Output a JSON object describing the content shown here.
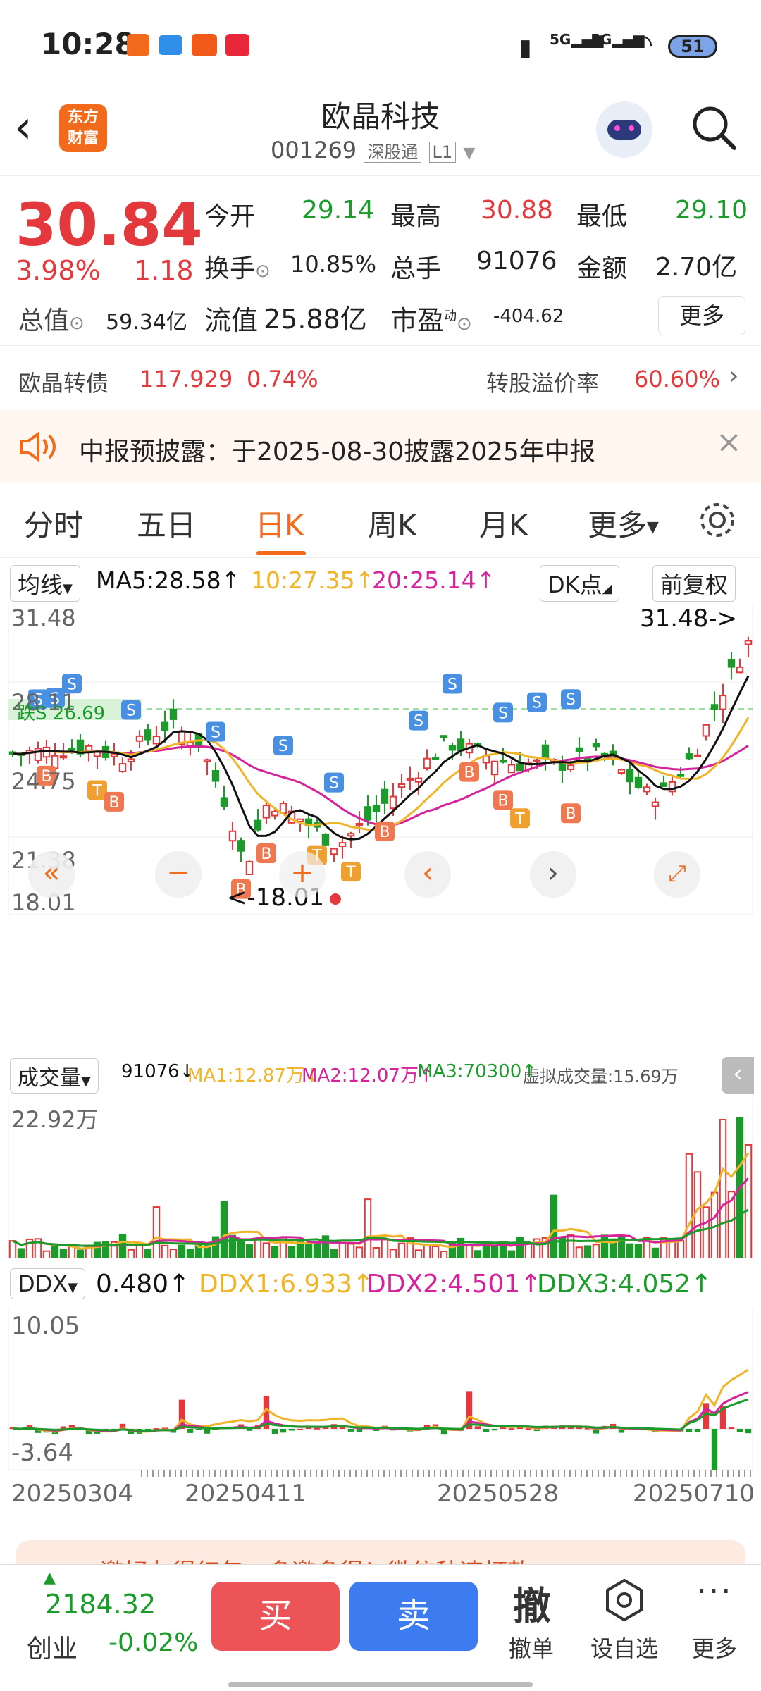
{
  "status_bar": {
    "time": "10:28",
    "battery": "51",
    "network1": "5G",
    "network2": "5G"
  },
  "header": {
    "title": "欧晶科技",
    "code": "001269",
    "market_tag": "深股通",
    "level_tag": "L1",
    "logo_text_1": "东方",
    "logo_text_2": "财富"
  },
  "quote": {
    "price": "30.84",
    "change_pct": "3.98%",
    "change_amt": "1.18",
    "open_label": "今开",
    "open": "29.14",
    "high_label": "最高",
    "high": "30.88",
    "low_label": "最低",
    "low": "29.10",
    "turnover_label": "换手",
    "turnover": "10.85%",
    "volume_label": "总手",
    "volume": "91076",
    "amount_label": "金额",
    "amount": "2.70亿",
    "mcap_label": "总值",
    "mcap": "59.34亿",
    "float_label": "流值",
    "float": "25.88亿",
    "pe_label": "市盈",
    "pe_sup": "动",
    "pe": "-404.62",
    "more_label": "更多"
  },
  "bond": {
    "name": "欧晶转债",
    "price": "117.929",
    "pct": "0.74%",
    "premium_label": "转股溢价率",
    "premium": "60.60%"
  },
  "notice": {
    "text": "中报预披露：于2025-08-30披露2025年中报"
  },
  "tabs": [
    "分时",
    "五日",
    "日K",
    "周K",
    "月K",
    "更多"
  ],
  "active_tab": 2,
  "kline": {
    "ma_select": "均线",
    "ma5": "MA5:28.58",
    "ma10": "10:27.35",
    "ma20": "20:25.14",
    "dk_label": "DK点",
    "adjust_label": "前复权",
    "y_max": "31.48",
    "y_2": "28.11",
    "y_3": "24.75",
    "y_4": "21.38",
    "y_min": "18.01",
    "max_tag": "31.48->",
    "min_tag": "<-18.01",
    "stop_label": "跌S",
    "stop_value": "26.69",
    "colors": {
      "up": "#e4393c",
      "down": "#1a9b2a",
      "ma5": "#111111",
      "ma10": "#f0b428",
      "ma20": "#d4239b"
    }
  },
  "volume": {
    "select": "成交量",
    "current": "91076",
    "ma1": "MA1:12.87万",
    "ma2": "MA2:12.07万",
    "ma3": "MA3:70300",
    "virtual": "虚拟成交量:15.69万",
    "y_max": "22.92万"
  },
  "ddx": {
    "select": "DDX",
    "current": "0.480",
    "ddx1": "DDX1:6.933",
    "ddx2": "DDX2:4.501",
    "ddx3": "DDX3:4.052",
    "y_max": "10.05",
    "y_min": "-3.64"
  },
  "x_axis": {
    "d1": "20250304",
    "d2": "20250411",
    "d3": "20250528",
    "d4": "20250710"
  },
  "bottom": {
    "index_value": "2184.32",
    "index_name": "创业",
    "index_pct": "-0.02%",
    "buy": "买",
    "sell": "卖",
    "cancel_icon": "撤",
    "cancel_label": "撤单",
    "watch_label": "设自选",
    "more_label": "更多",
    "banner": "邀好友得红包，多邀多得！微信秒速打款"
  }
}
